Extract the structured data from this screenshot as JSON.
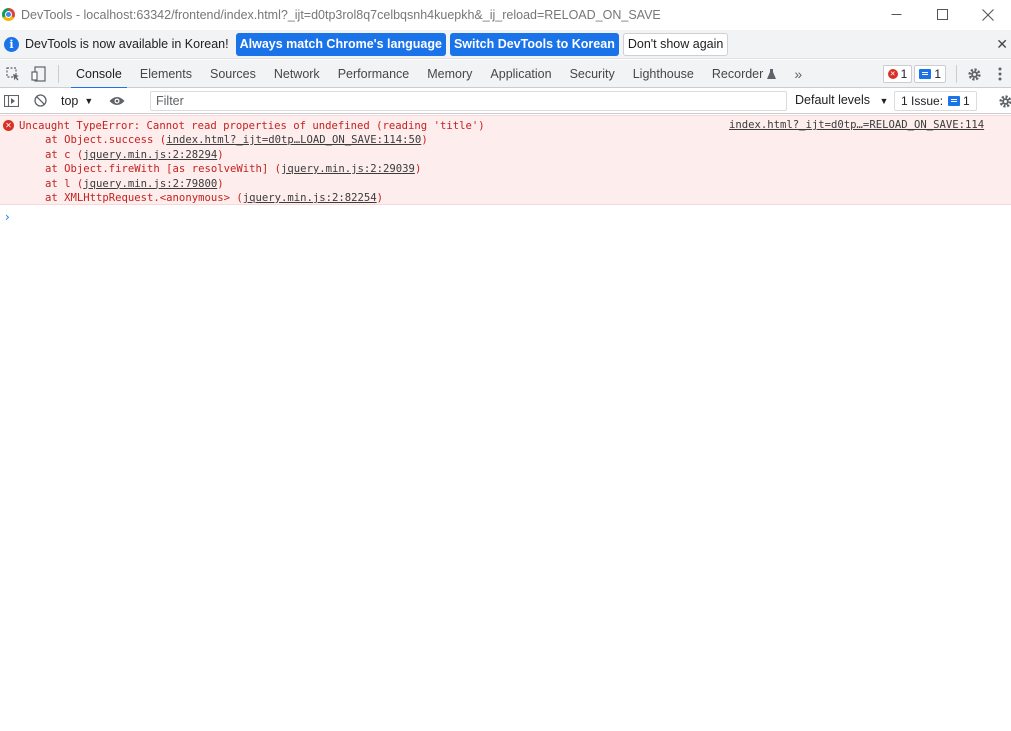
{
  "window": {
    "title": "DevTools - localhost:63342/frontend/index.html?_ijt=d0tp3rol8q7celbqsnh4kuepkh&_ij_reload=RELOAD_ON_SAVE"
  },
  "infobar": {
    "message": "DevTools is now available in Korean!",
    "match_label": "Always match Chrome's language",
    "switch_label": "Switch DevTools to Korean",
    "dismiss_label": "Don't show again"
  },
  "tabs": [
    {
      "label": "Console",
      "active": true
    },
    {
      "label": "Elements"
    },
    {
      "label": "Sources"
    },
    {
      "label": "Network"
    },
    {
      "label": "Performance"
    },
    {
      "label": "Memory"
    },
    {
      "label": "Application"
    },
    {
      "label": "Security"
    },
    {
      "label": "Lighthouse"
    },
    {
      "label": "Recorder"
    }
  ],
  "counters": {
    "errors": "1",
    "messages": "1"
  },
  "console_toolbar": {
    "context": "top",
    "filter_placeholder": "Filter",
    "levels": "Default levels",
    "issues_label": "1 Issue:",
    "issues_count": "1"
  },
  "error": {
    "message": "Uncaught TypeError: Cannot read properties of undefined (reading 'title')",
    "source": "index.html?_ijt=d0tp…=RELOAD_ON_SAVE:114",
    "stack": [
      {
        "prefix": "at Object.success (",
        "link": "index.html?_ijt=d0tp…LOAD_ON_SAVE:114:50",
        "suffix": ")"
      },
      {
        "prefix": "at c (",
        "link": "jquery.min.js:2:28294",
        "suffix": ")"
      },
      {
        "prefix": "at Object.fireWith [as resolveWith] (",
        "link": "jquery.min.js:2:29039",
        "suffix": ")"
      },
      {
        "prefix": "at l (",
        "link": "jquery.min.js:2:79800",
        "suffix": ")"
      },
      {
        "prefix": "at XMLHttpRequest.<anonymous> (",
        "link": "jquery.min.js:2:82254",
        "suffix": ")"
      }
    ]
  },
  "colors": {
    "accent": "#1a73e8",
    "error_bg": "#fdeded",
    "error_text": "#c5221f"
  }
}
